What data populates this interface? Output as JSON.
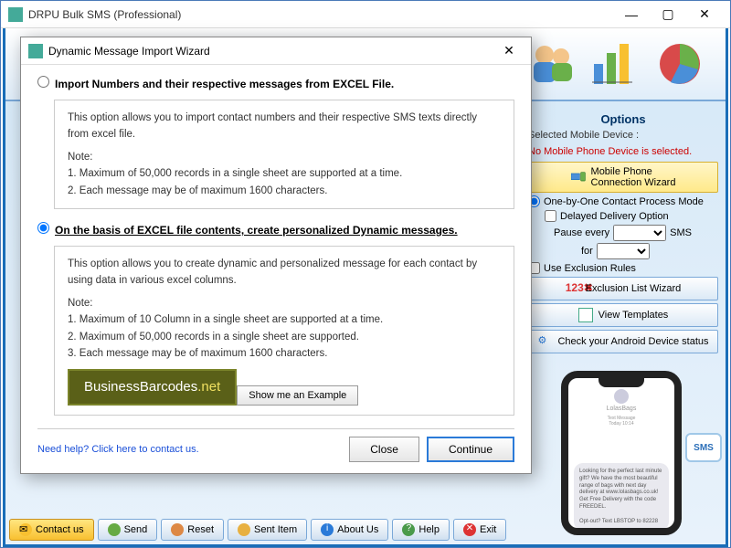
{
  "app": {
    "title": "DRPU Bulk SMS (Professional)"
  },
  "modal": {
    "title": "Dynamic Message Import Wizard",
    "opt1_label": "Import Numbers and their respective messages from EXCEL File.",
    "opt1_desc": "This option allows you to import contact numbers and their respective SMS texts directly from excel file.",
    "opt1_note_title": "Note:",
    "opt1_note_1": "1. Maximum of 50,000 records in a single sheet are supported at a time.",
    "opt1_note_2": "2. Each message may be of maximum 1600 characters.",
    "opt2_label": "On the basis of EXCEL file contents, create personalized Dynamic messages.",
    "opt2_desc": "This option allows you to create dynamic and personalized message for each contact by using data in various excel columns.",
    "opt2_note_title": "Note:",
    "opt2_note_1": "1. Maximum of 10 Column in a single sheet are supported at a time.",
    "opt2_note_2": "2. Maximum of 50,000 records in a single sheet are supported.",
    "opt2_note_3": "3. Each message may be of maximum 1600 characters.",
    "watermark_a": "BusinessBarcodes",
    "watermark_b": ".net",
    "example_btn": "Show me an Example",
    "help_link": "Need help? Click here to contact us.",
    "close_btn": "Close",
    "continue_btn": "Continue"
  },
  "options": {
    "title": "Options",
    "device_label": "Selected Mobile Device :",
    "device_status": "No Mobile Phone Device is selected.",
    "wizard_btn_l1": "Mobile Phone",
    "wizard_btn_l2": "Connection  Wizard",
    "mode_label": "One-by-One Contact Process Mode",
    "delayed_label": "Delayed Delivery Option",
    "pause_label": "Pause every",
    "pause_unit": "SMS",
    "for_label": "for",
    "exclusion_cb": "Use Exclusion Rules",
    "exclusion_btn": "Exclusion List Wizard",
    "templates_btn": "View Templates",
    "android_btn": "Check your Android Device status"
  },
  "toolbar": {
    "contact": "Contact us",
    "send": "Send",
    "reset": "Reset",
    "sent": "Sent Item",
    "about": "About Us",
    "help": "Help",
    "exit": "Exit"
  },
  "phone": {
    "contact_name": "LolasBags",
    "msg_header": "Text Message",
    "msg_time": "Today 10:14",
    "body": "Looking for the perfect last minute gift? We have the most beautiful range of bags with next day delivery at www.lolasbags.co.uk! Get Free Delivery with the code FREEDEL.",
    "optout": "Opt-out? Text LBSTOP to 82228"
  },
  "sms_badge": "SMS"
}
